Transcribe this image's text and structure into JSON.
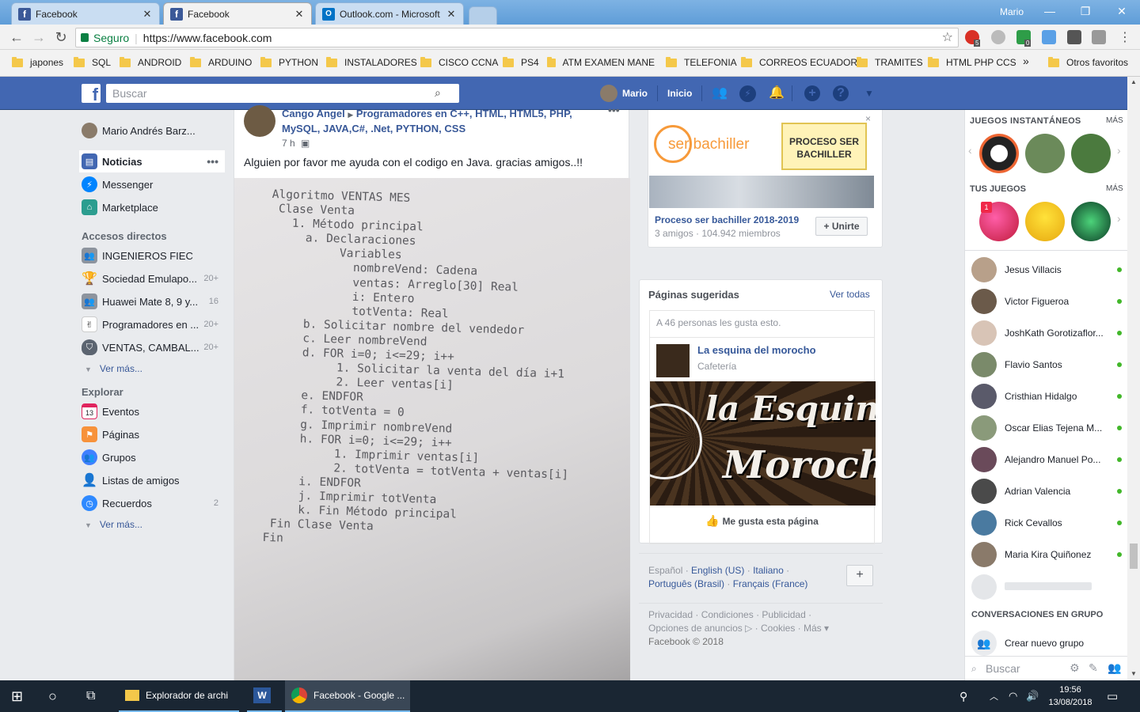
{
  "browser": {
    "tabs": [
      {
        "title": "Facebook",
        "icon": "facebook-icon"
      },
      {
        "title": "Facebook",
        "icon": "facebook-icon"
      },
      {
        "title": "Outlook.com - Microsoft",
        "icon": "outlook-icon"
      }
    ],
    "profile_name": "Mario",
    "security_label": "Seguro",
    "url": "https://www.facebook.com",
    "ext_badges": [
      "5",
      "0"
    ],
    "bookmarks": [
      "japones",
      "SQL",
      "ANDROID",
      "ARDUINO",
      "PYTHON",
      "INSTALADORES",
      "CISCO CCNA",
      "PS4",
      "ATM EXAMEN MANE",
      "TELEFONIA",
      "CORREOS ECUADOR",
      "TRAMITES",
      "HTML PHP CCS"
    ],
    "bookmarks_overflow": "»",
    "other_bookmarks": "Otros favoritos"
  },
  "fb_header": {
    "search_placeholder": "Buscar",
    "user_name": "Mario",
    "home_label": "Inicio"
  },
  "left_nav": {
    "profile_name": "Mario Andrés Barz...",
    "primary": [
      {
        "label": "Noticias",
        "more": "•••"
      },
      {
        "label": "Messenger"
      },
      {
        "label": "Marketplace"
      }
    ],
    "shortcuts_title": "Accesos directos",
    "shortcuts": [
      {
        "label": "INGENIEROS FIEC",
        "count": ""
      },
      {
        "label": "Sociedad Emulapo...",
        "count": "20+"
      },
      {
        "label": "Huawei Mate 8, 9 y...",
        "count": "16"
      },
      {
        "label": "Programadores en ...",
        "count": "20+"
      },
      {
        "label": "VENTAS, CAMBAL...",
        "count": "20+"
      }
    ],
    "see_more": "Ver más...",
    "explore_title": "Explorar",
    "explore": [
      {
        "label": "Eventos",
        "count": "",
        "icon_text": "13"
      },
      {
        "label": "Páginas",
        "count": ""
      },
      {
        "label": "Grupos",
        "count": ""
      },
      {
        "label": "Listas de amigos",
        "count": ""
      },
      {
        "label": "Recuerdos",
        "count": "2"
      }
    ],
    "see_more_2": "Ver más..."
  },
  "post": {
    "author": "Cango Angel",
    "group": "Programadores en C++, HTML, HTML5, PHP, MySQL, JAVA,C#, .Net, PYTHON, CSS",
    "time": "7 h",
    "more": "•••",
    "text": "Alguien por favor me ayuda con el codigo en Java. gracias amigos..!!",
    "image_lines": [
      "Algoritmo VENTAS MES",
      " Clase Venta",
      "   1. Método principal",
      "     a. Declaraciones",
      "          Variables",
      "            nombreVend: Cadena",
      "            ventas: Arreglo[30] Real",
      "            i: Entero",
      "            totVenta: Real",
      "     b. Solicitar nombre del vendedor",
      "     c. Leer nombreVend",
      "     d. FOR i=0; i<=29; i++",
      "          1. Solicitar la venta del día i+1",
      "          2. Leer ventas[i]",
      "     e. ENDFOR",
      "     f. totVenta = 0",
      "     g. Imprimir nombreVend",
      "     h. FOR i=0; i<=29; i++",
      "          1. Imprimir ventas[i]",
      "          2. totVenta = totVenta + ventas[i]",
      "     i. ENDFOR",
      "     j. Imprimir totVenta",
      "     k. Fin Método principal",
      " Fin Clase Venta",
      "Fin"
    ]
  },
  "group_ad": {
    "logo_text": "ser bachiller",
    "banner_text": "PROCESO SER BACHILLER",
    "title": "Proceso ser bachiller 2018-2019",
    "meta": "3 amigos · 104.942 miembros",
    "join_label": "+ Unirte",
    "close": "×"
  },
  "suggested_pages": {
    "title": "Páginas sugeridas",
    "see_all": "Ver todas",
    "likes_text": "A 46 personas les gusta esto.",
    "page_name": "La esquina del morocho",
    "page_category": "Cafetería",
    "cover_text_1": "la Esquina de",
    "cover_text_2": "Morocho",
    "like_label": "Me gusta esta página"
  },
  "footer": {
    "languages": [
      "Español",
      "English (US)",
      "Italiano",
      "Português (Brasil)",
      "Français (France)"
    ],
    "add": "+",
    "links_1": "Privacidad · Condiciones · Publicidad ·",
    "links_2": "Opciones de anuncios ▷ · Cookies · Más ▾",
    "copyright": "Facebook © 2018"
  },
  "chat": {
    "instant_games_title": "JUEGOS INSTANTÁNEOS",
    "more": "MÁS",
    "your_games_title": "TUS JUEGOS",
    "game_badge": "1",
    "contacts": [
      "Jesus Villacis",
      "Victor Figueroa",
      "JoshKath Gorotizaflor...",
      "Flavio Santos",
      "Cristhian Hidalgo",
      "Oscar Elias Tejena M...",
      "Alejandro Manuel Po...",
      "Adrian Valencia",
      "Rick Cevallos",
      "Maria Kira Quiñonez"
    ],
    "group_conversations_title": "CONVERSACIONES EN GRUPO",
    "create_group": "Crear nuevo grupo",
    "search_placeholder": "Buscar"
  },
  "taskbar": {
    "apps": [
      "Explorador de archi",
      "Facebook - Google ..."
    ],
    "time": "19:56",
    "date": "13/08/2018"
  },
  "colors": {
    "facebook_blue": "#4267b2",
    "link_blue": "#385898",
    "online_green": "#42b72a",
    "taskbar": "#1a2633"
  }
}
